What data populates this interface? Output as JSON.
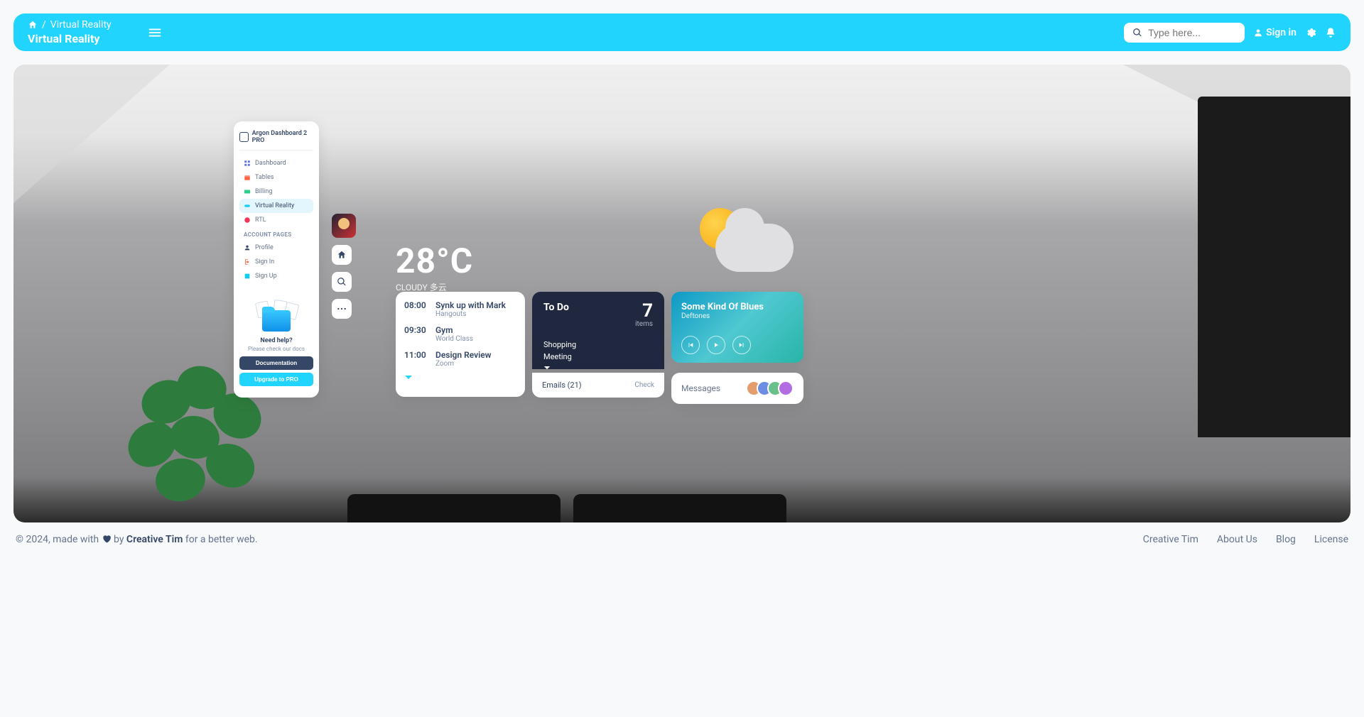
{
  "navbar": {
    "breadcrumb_current": "Virtual Reality",
    "title": "Virtual Reality",
    "search_placeholder": "Type here...",
    "sign_in": "Sign in"
  },
  "sidebar": {
    "brand": "Argon Dashboard 2 PRO",
    "items": [
      {
        "label": "Dashboard"
      },
      {
        "label": "Tables"
      },
      {
        "label": "Billing"
      },
      {
        "label": "Virtual Reality"
      },
      {
        "label": "RTL"
      }
    ],
    "section_label": "ACCOUNT PAGES",
    "account_items": [
      {
        "label": "Profile"
      },
      {
        "label": "Sign In"
      },
      {
        "label": "Sign Up"
      }
    ],
    "help_title": "Need help?",
    "help_sub": "Please check our docs",
    "doc_btn": "Documentation",
    "upgrade_btn": "Upgrade to PRO"
  },
  "weather": {
    "temp": "28°C",
    "desc": "CLOUDY 多云"
  },
  "schedule": [
    {
      "time": "08:00",
      "title": "Synk up with Mark",
      "sub": "Hangouts"
    },
    {
      "time": "09:30",
      "title": "Gym",
      "sub": "World Class"
    },
    {
      "time": "11:00",
      "title": "Design Review",
      "sub": "Zoom"
    }
  ],
  "todo": {
    "title": "To Do",
    "count": "7",
    "items_label": "items",
    "list": [
      "Shopping",
      "Meeting"
    ]
  },
  "emails": {
    "label": "Emails (21)",
    "action": "Check"
  },
  "music": {
    "title": "Some Kind Of Blues",
    "artist": "Deftones"
  },
  "messages": {
    "label": "Messages"
  },
  "footer": {
    "prefix": "© 2024, made with ",
    "by": " by ",
    "author": "Creative Tim",
    "suffix": " for a better web.",
    "links": [
      "Creative Tim",
      "About Us",
      "Blog",
      "License"
    ]
  }
}
